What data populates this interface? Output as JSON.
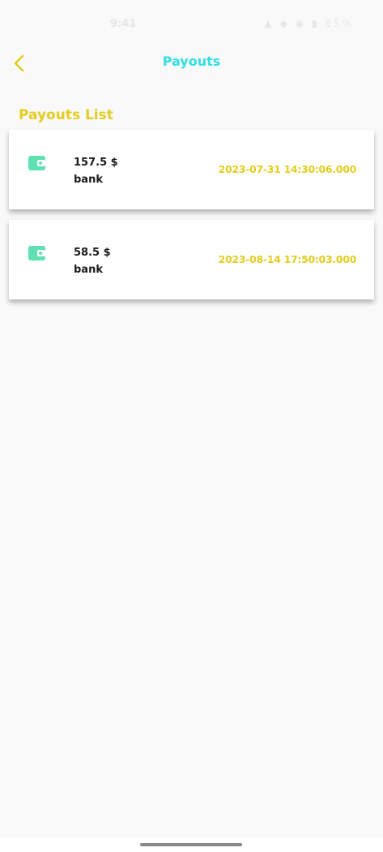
{
  "status_bar": {
    "time": "9:41",
    "icons": "▲ ◆ ◉ ▮ 85%"
  },
  "header": {
    "title": "Payouts",
    "back_icon": "chevron-left-icon"
  },
  "colors": {
    "accent_yellow": "#e4cd20",
    "title_cyan": "#2ee0e6",
    "wallet_green": "#5ee0b0"
  },
  "section": {
    "title": "Payouts List"
  },
  "payouts": [
    {
      "amount": "157.5 $",
      "method": "bank",
      "date": "2023-07-31 14:30:06.000",
      "icon": "wallet-icon"
    },
    {
      "amount": "58.5 $",
      "method": "bank",
      "date": "2023-08-14 17:50:03.000",
      "icon": "wallet-icon"
    }
  ]
}
